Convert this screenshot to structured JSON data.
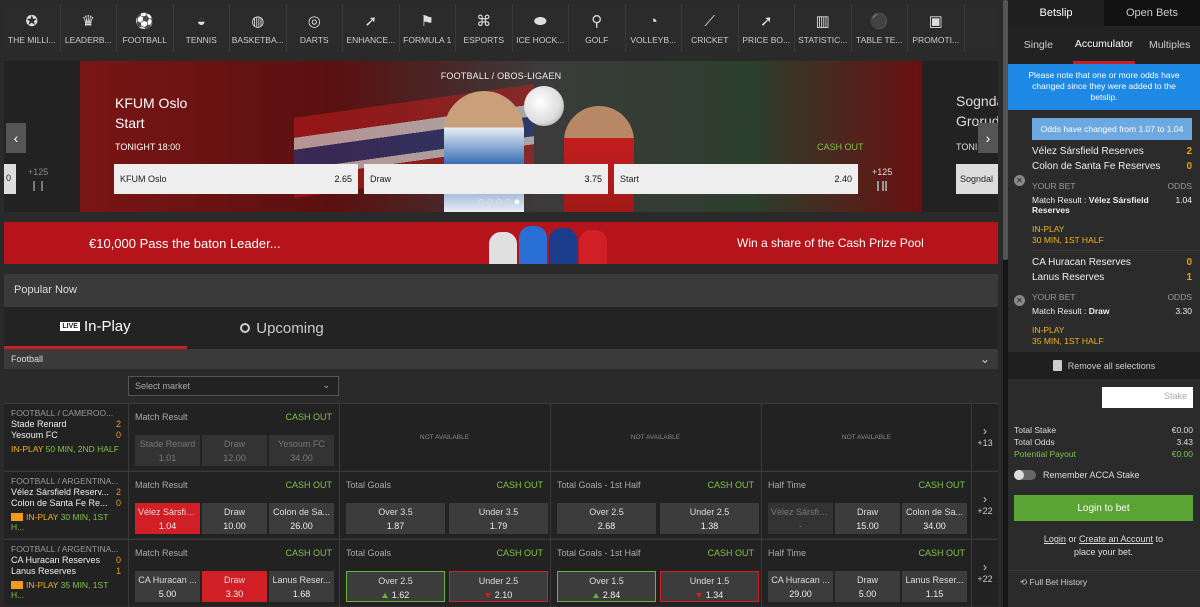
{
  "sports": [
    {
      "label": "THE MILLI...",
      "icon": "medal-icon",
      "glyph": "✪"
    },
    {
      "label": "LEADERB...",
      "icon": "trophy-icon",
      "glyph": "♛"
    },
    {
      "label": "FOOTBALL",
      "icon": "football-icon",
      "glyph": "⚽"
    },
    {
      "label": "TENNIS",
      "icon": "tennis-icon",
      "glyph": "◒"
    },
    {
      "label": "BASKETBA...",
      "icon": "basketball-icon",
      "glyph": "◍"
    },
    {
      "label": "DARTS",
      "icon": "darts-icon",
      "glyph": "◎"
    },
    {
      "label": "ENHANCE...",
      "icon": "enhanced-arrow-icon",
      "glyph": "➚"
    },
    {
      "label": "FORMULA 1",
      "icon": "checkered-flag-icon",
      "glyph": "⚑"
    },
    {
      "label": "ESPORTS",
      "icon": "gamepad-icon",
      "glyph": "⌘"
    },
    {
      "label": "ICE HOCK...",
      "icon": "hockey-puck-icon",
      "glyph": "⬬"
    },
    {
      "label": "GOLF",
      "icon": "golf-icon",
      "glyph": "⚲"
    },
    {
      "label": "VOLLEYB...",
      "icon": "volleyball-icon",
      "glyph": "◔"
    },
    {
      "label": "CRICKET",
      "icon": "cricket-bat-icon",
      "glyph": "⟋"
    },
    {
      "label": "PRICE BO...",
      "icon": "price-boost-icon",
      "glyph": "➚"
    },
    {
      "label": "STATISTIC...",
      "icon": "bar-chart-icon",
      "glyph": "▥"
    },
    {
      "label": "TABLE TE...",
      "icon": "table-tennis-icon",
      "glyph": "⚫"
    },
    {
      "label": "PROMOTI...",
      "icon": "gift-icon",
      "glyph": "▣"
    }
  ],
  "hero": {
    "breadcrumb": "FOOTBALL / OBOS-LIGAEN",
    "title_line1": "KFUM Oslo",
    "title_line2": "Start",
    "time": "TONIGHT 18:00",
    "cash_out": "CASH OUT",
    "odds": [
      {
        "name": "KFUM Oslo",
        "value": "2.65"
      },
      {
        "name": "Draw",
        "value": "3.75"
      },
      {
        "name": "Start",
        "value": "2.40"
      }
    ],
    "more": "+125",
    "left_more": "+125",
    "left_card": "0",
    "right_title_line1": "Sogndal",
    "right_title_line2": "Grorud",
    "right_card": "Sogndal",
    "right_card_tag": "TONI"
  },
  "promo": {
    "left": "€10,000 Pass the baton Leader...",
    "right": "Win a share of the Cash Prize Pool"
  },
  "popular": {
    "title": "Popular Now",
    "tab_inplay": "In-Play",
    "tab_upcoming": "Upcoming",
    "live_badge": "LIVE",
    "section": "Football",
    "select_market": "Select market"
  },
  "rows": [
    {
      "league": "FOOTBALL / CAMEROO...",
      "team1": "Stade Renard",
      "score1": "2",
      "team2": "Yesoum FC",
      "score2": "0",
      "status_prefix": "IN-PLAY",
      "status": "50 MIN, 2ND HALF",
      "match_result": {
        "title": "Match Result",
        "cash": "CASH OUT",
        "odds": [
          {
            "n": "Stade Renard",
            "v": "1.01"
          },
          {
            "n": "Draw",
            "v": "12.00"
          },
          {
            "n": "Yesoum FC",
            "v": "34.00"
          }
        ]
      },
      "na": "NOT AVAILABLE",
      "more": "+13"
    },
    {
      "league": "FOOTBALL / ARGENTINA...",
      "team1": "Vélez Sársfield Reserv...",
      "score1": "2",
      "team2": "Colon de Santa Fe Re...",
      "score2": "0",
      "status_prefix": "IN-PLAY",
      "status": "30 MIN, 1ST H...",
      "match_result": {
        "title": "Match Result",
        "cash": "CASH OUT",
        "odds": [
          {
            "n": "Vélez Sársfiel...",
            "v": "1.04"
          },
          {
            "n": "Draw",
            "v": "10.00"
          },
          {
            "n": "Colon de Sa...",
            "v": "26.00"
          }
        ]
      },
      "total_goals": {
        "title": "Total Goals",
        "cash": "CASH OUT",
        "odds": [
          {
            "n": "Over 3.5",
            "v": "1.87"
          },
          {
            "n": "Under 3.5",
            "v": "1.79"
          }
        ]
      },
      "total_goals_1h": {
        "title": "Total Goals - 1st Half",
        "cash": "CASH OUT",
        "odds": [
          {
            "n": "Over 2.5",
            "v": "2.68"
          },
          {
            "n": "Under 2.5",
            "v": "1.38"
          }
        ]
      },
      "half_time": {
        "title": "Half Time",
        "cash": "CASH OUT",
        "odds": [
          {
            "n": "Vélez Sársfiel...",
            "v": "-"
          },
          {
            "n": "Draw",
            "v": "15.00"
          },
          {
            "n": "Colon de Sa...",
            "v": "34.00"
          }
        ]
      },
      "more": "+22"
    },
    {
      "league": "FOOTBALL / ARGENTINA...",
      "team1": "CA Huracan Reserves",
      "score1": "0",
      "team2": "Lanus Reserves",
      "score2": "1",
      "status_prefix": "IN-PLAY",
      "status": "35 MIN, 1ST H...",
      "match_result": {
        "title": "Match Result",
        "cash": "CASH OUT",
        "odds": [
          {
            "n": "CA Huracan ...",
            "v": "5.00"
          },
          {
            "n": "Draw",
            "v": "3.30"
          },
          {
            "n": "Lanus Reser...",
            "v": "1.68"
          }
        ]
      },
      "total_goals": {
        "title": "Total Goals",
        "cash": "CASH OUT",
        "odds": [
          {
            "n": "Over 2.5",
            "v": "1.62"
          },
          {
            "n": "Under 2.5",
            "v": "2.10"
          }
        ]
      },
      "total_goals_1h": {
        "title": "Total Goals - 1st Half",
        "cash": "CASH OUT",
        "odds": [
          {
            "n": "Over 1.5",
            "v": "2.84"
          },
          {
            "n": "Under 1.5",
            "v": "1.34"
          }
        ]
      },
      "half_time": {
        "title": "Half Time",
        "cash": "CASH OUT",
        "odds": [
          {
            "n": "CA Huracan ...",
            "v": "29.00"
          },
          {
            "n": "Draw",
            "v": "5.00"
          },
          {
            "n": "Lanus Reser...",
            "v": "1.15"
          }
        ]
      },
      "more": "+22"
    }
  ],
  "betslip": {
    "tab_betslip": "Betslip",
    "tab_open": "Open Bets",
    "sub_single": "Single",
    "sub_acc": "Accumulator",
    "sub_multi": "Multiples",
    "notice": "Please note that one or more odds have changed since they were added to the betslip.",
    "odds_changed": "Odds have changed from 1.07 to 1.04",
    "sel1": {
      "team1": "Vélez Sársfield Reserves",
      "s1": "2",
      "team2": "Colon de Santa Fe Reserves",
      "s2": "0",
      "your_bet": "YOUR BET",
      "odds_lbl": "ODDS",
      "res_prefix": "Match Result :",
      "res_sel": "Vélez Sársfield Reserves",
      "odds": "1.04",
      "inplay": "IN-PLAY",
      "status": "30 MIN, 1ST HALF"
    },
    "sel2": {
      "team1": "CA Huracan Reserves",
      "s1": "0",
      "team2": "Lanus Reserves",
      "s2": "1",
      "your_bet": "YOUR BET",
      "odds_lbl": "ODDS",
      "res_prefix": "Match Result :",
      "res_sel": "Draw",
      "odds": "3.30",
      "inplay": "IN-PLAY",
      "status": "35 MIN, 1ST HALF"
    },
    "remove": "Remove all selections",
    "stake_placeholder": "Stake",
    "total_stake_lbl": "Total Stake",
    "total_stake": "€0.00",
    "total_odds_lbl": "Total Odds",
    "total_odds": "3.43",
    "payout_lbl": "Potential Payout",
    "payout": "€0.00",
    "remember": "Remember ACCA Stake",
    "login": "Login to bet",
    "login_link": "Login",
    "or": "or",
    "create": "Create an Account",
    "to": "to",
    "place": "place your bet.",
    "history": "Full Bet History"
  }
}
